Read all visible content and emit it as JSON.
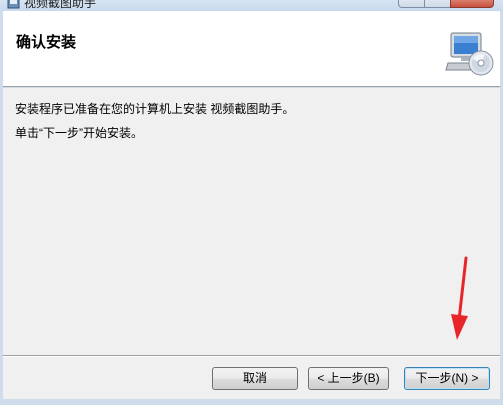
{
  "window": {
    "title": "视频截图助手"
  },
  "header": {
    "title": "确认安装",
    "icon": "computer-disc-icon"
  },
  "body": {
    "line1": "安装程序已准备在您的计算机上安装 视频截图助手。",
    "line2": "单击“下一步”开始安装。"
  },
  "buttons": {
    "cancel": "取消",
    "back": "< 上一步(B)",
    "next": "下一步(N) >"
  },
  "colors": {
    "annotation_arrow": "#e8262a",
    "frame": "#cfdcec",
    "header_bg": "#ffffff",
    "body_bg": "#f0f0f0"
  }
}
